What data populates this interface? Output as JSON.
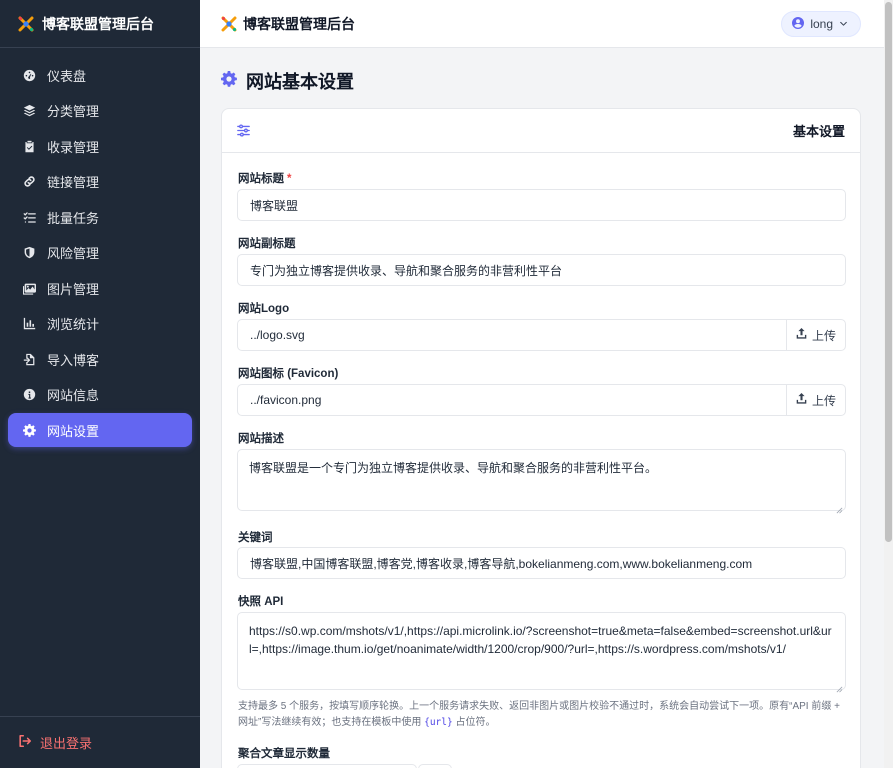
{
  "sidebar": {
    "brand": "博客联盟管理后台",
    "items": [
      {
        "label": "仪表盘",
        "icon": "dashboard-icon"
      },
      {
        "label": "分类管理",
        "icon": "layers-icon"
      },
      {
        "label": "收录管理",
        "icon": "clipboard-check-icon"
      },
      {
        "label": "链接管理",
        "icon": "link-icon"
      },
      {
        "label": "批量任务",
        "icon": "list-check-icon"
      },
      {
        "label": "风险管理",
        "icon": "shield-icon"
      },
      {
        "label": "图片管理",
        "icon": "image-icon"
      },
      {
        "label": "浏览统计",
        "icon": "bar-chart-icon"
      },
      {
        "label": "导入博客",
        "icon": "file-import-icon"
      },
      {
        "label": "网站信息",
        "icon": "info-icon"
      },
      {
        "label": "网站设置",
        "icon": "gear-icon",
        "active": true
      }
    ],
    "logout": "退出登录"
  },
  "topbar": {
    "title": "博客联盟管理后台",
    "user": "long"
  },
  "page": {
    "title": "网站基本设置"
  },
  "card": {
    "title": "基本设置",
    "fields": {
      "site_title": {
        "label": "网站标题",
        "required": "*",
        "value": "博客联盟"
      },
      "site_subtitle": {
        "label": "网站副标题",
        "value": "专门为独立博客提供收录、导航和聚合服务的非营利性平台"
      },
      "site_logo": {
        "label": "网站Logo",
        "value": "../logo.svg",
        "button": "上传"
      },
      "site_favicon": {
        "label": "网站图标 (Favicon)",
        "value": "../favicon.png",
        "button": "上传"
      },
      "site_description": {
        "label": "网站描述",
        "value": "博客联盟是一个专门为独立博客提供收录、导航和聚合服务的非营利性平台。"
      },
      "keywords": {
        "label": "关键词",
        "value": "博客联盟,中国博客联盟,博客党,博客收录,博客导航,bokelianmeng.com,www.bokelianmeng.com"
      },
      "snapshot_api": {
        "label": "快照 API",
        "value": "https://s0.wp.com/mshots/v1/,https://api.microlink.io/?screenshot=true&meta=false&embed=screenshot.url&url=,https://image.thum.io/get/noanimate/width/1200/crop/900/?url=,https://s.wordpress.com/mshots/v1/",
        "hint_before": "支持最多 5 个服务，按填写顺序轮换。上一个服务请求失败、返回非图片或图片校验不通过时，系统会自动尝试下一项。原有“API 前缀 + 网址”写法继续有效；也支持在模板中使用 ",
        "hint_code": "{url}",
        "hint_after": " 占位符。"
      },
      "aggregate_count": {
        "label": "聚合文章显示数量"
      }
    }
  },
  "colors": {
    "sidebar_bg": "#1f2937",
    "accent": "#6366f1",
    "logout": "#f87171",
    "required": "#ef4444"
  }
}
